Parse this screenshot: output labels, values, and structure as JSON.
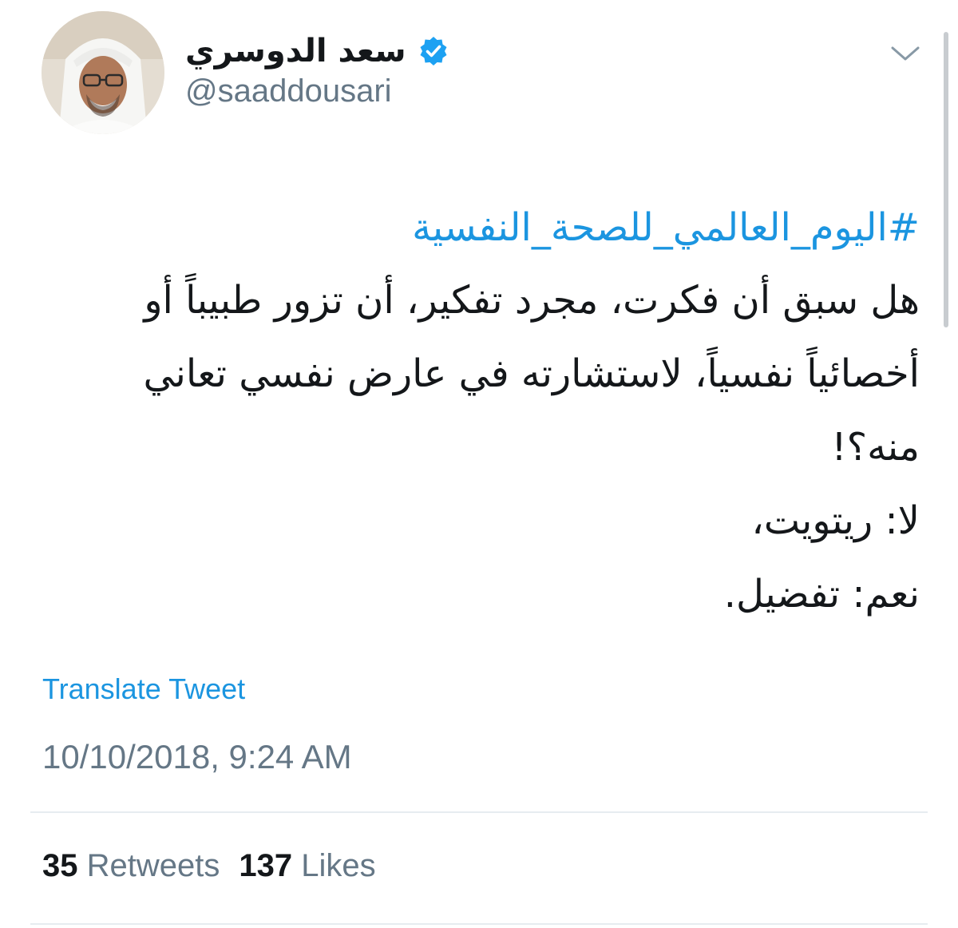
{
  "user": {
    "display_name": "سعد الدوسري",
    "handle": "@saaddousari",
    "verified": true,
    "avatar_icon": "profile-photo"
  },
  "tweet": {
    "hashtag": "#اليوم_العالمي_للصحة_النفسية",
    "lines": [
      "هل سبق أن فكرت، مجرد تفكير، أن تزور طبيباً أو أخصائياً نفسياً، لاستشارته في عارض نفسي تعاني منه؟!",
      "لا: ريتويت،",
      "نعم: تفضيل."
    ],
    "translate_label": "Translate Tweet",
    "timestamp": "10/10/2018, 9:24 AM"
  },
  "stats": {
    "retweets_count": "35",
    "retweets_label": "Retweets",
    "likes_count": "137",
    "likes_label": "Likes"
  },
  "icons": {
    "verified": "verified-badge-icon",
    "menu": "chevron-down-icon"
  },
  "colors": {
    "link": "#1b95e0",
    "muted": "#657786",
    "text": "#14171a",
    "divider": "#e6ecf0"
  }
}
